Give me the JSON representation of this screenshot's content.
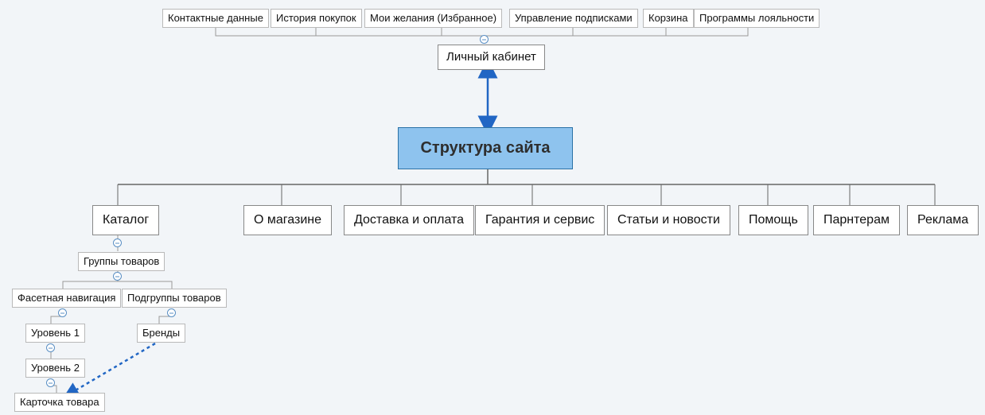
{
  "central": "Структура сайта",
  "account": {
    "title": "Личный кабинет",
    "children": [
      "Контактные данные",
      "История покупок",
      "Мои желания (Избранное)",
      "Управление подписками",
      "Корзина",
      "Программы лояльности"
    ]
  },
  "sections": [
    "Каталог",
    "О магазине",
    "Доставка и оплата",
    "Гарантия и сервис",
    "Статьи и новости",
    "Помощь",
    "Парнтерам",
    "Реклама"
  ],
  "catalog_tree": {
    "groups": "Группы товаров",
    "facet": "Фасетная навигация",
    "subgroups": "Подгруппы товаров",
    "brands": "Бренды",
    "level1": "Уровень 1",
    "level2": "Уровень 2",
    "card": "Карточка товара"
  }
}
